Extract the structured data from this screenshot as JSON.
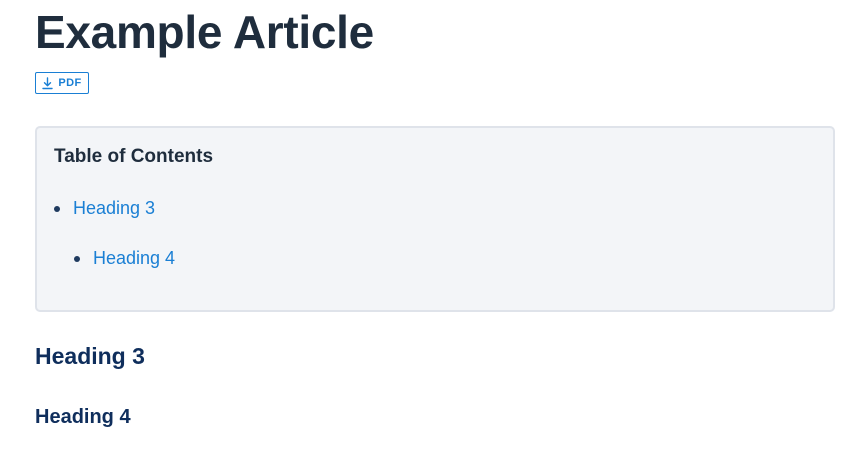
{
  "article": {
    "title": "Example Article",
    "pdf_label": "PDF"
  },
  "toc": {
    "title": "Table of Contents",
    "items": [
      {
        "label": "Heading 3",
        "level": 1
      },
      {
        "label": "Heading 4",
        "level": 2
      }
    ]
  },
  "content": {
    "heading3": "Heading 3",
    "heading4": "Heading 4"
  },
  "colors": {
    "title": "#1f2d3d",
    "link": "#1a7fd4",
    "heading": "#0f2e5c",
    "toc_bg": "#f3f5f8",
    "toc_border": "#dfe3ea"
  },
  "icons": {
    "pdf": "download-icon"
  }
}
